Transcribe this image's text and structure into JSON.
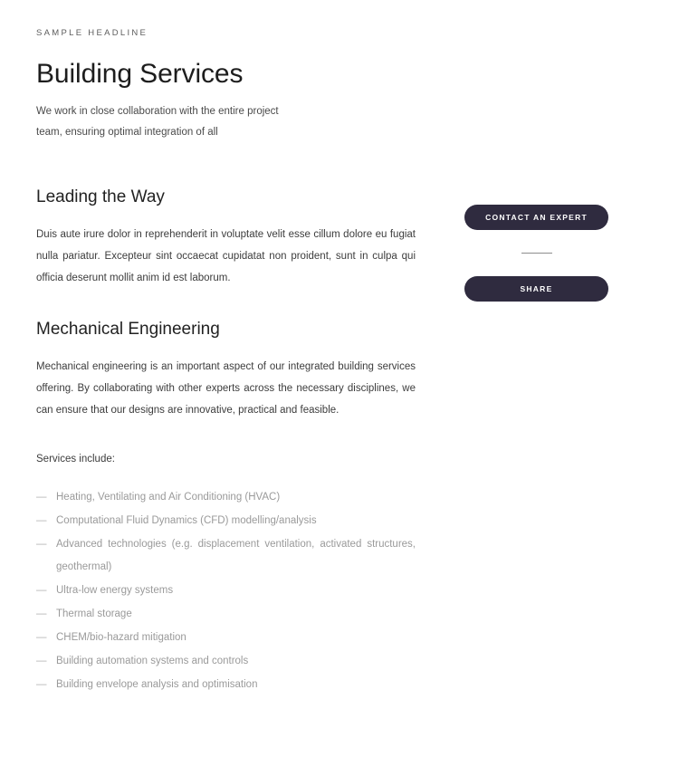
{
  "hero": {
    "eyebrow": "SAMPLE HEADLINE",
    "title": "Building Services",
    "subtitle": "We work in close collaboration with the entire project team, ensuring optimal integration of all"
  },
  "sections": {
    "leading": {
      "heading": "Leading the Way",
      "paragraph": "Duis aute irure dolor in reprehenderit in voluptate velit esse cillum dolore eu fugiat nulla pariatur. Excepteur sint occaecat cupidatat non proident, sunt in culpa qui officia deserunt mollit anim id est laborum."
    },
    "mechanical": {
      "heading": "Mechanical Engineering",
      "paragraph": "Mechanical engineering is an important aspect of our integrated building services offering. By collaborating with other experts across the necessary disciplines, we can ensure that our designs are innovative, practical and feasible."
    }
  },
  "services": {
    "label": "Services include:",
    "bullet": "—",
    "items": [
      "Heating, Ventilating and Air Conditioning (HVAC)",
      "Computational Fluid Dynamics (CFD) modelling/analysis",
      "Advanced technologies (e.g. displacement ventilation, activated structures, geothermal)",
      "Ultra-low energy systems",
      "Thermal storage",
      "CHEM/bio-hazard mitigation",
      "Building automation systems and controls",
      "Building envelope analysis and optimisation"
    ]
  },
  "cta": {
    "contact_label": "CONTACT AN EXPERT",
    "share_label": "SHARE"
  },
  "colors": {
    "button_bg": "#2f2b3f",
    "button_text": "#ffffff",
    "body_text": "#3c3c3c",
    "muted_text": "#9a9a9a",
    "heading_text": "#222222",
    "page_bg": "#ffffff",
    "divider": "#8d8d8d"
  }
}
